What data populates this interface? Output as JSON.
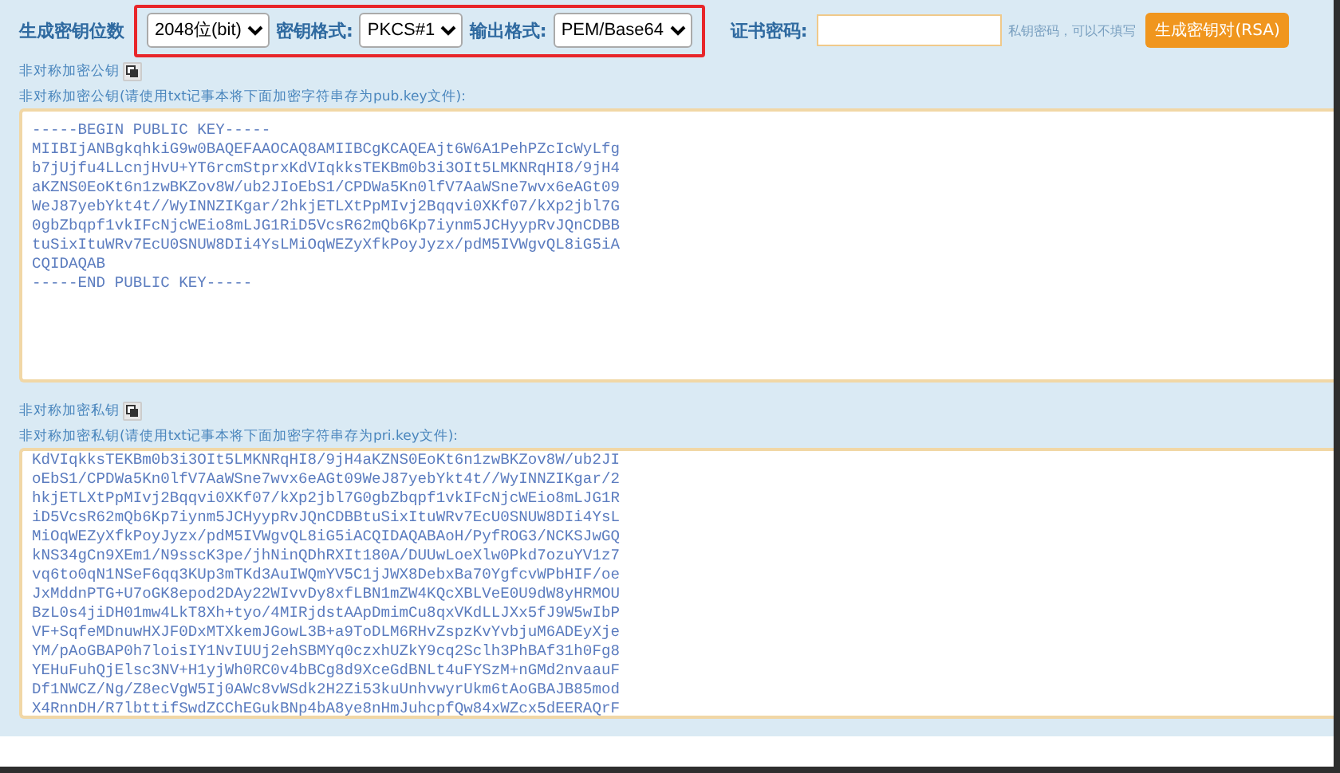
{
  "toolbar": {
    "key_size": {
      "label": "生成密钥位数",
      "value": "2048位(bit)"
    },
    "key_format": {
      "label": "密钥格式:",
      "value": "PKCS#1"
    },
    "output_format": {
      "label": "输出格式:",
      "value": "PEM/Base64"
    },
    "password": {
      "label": "证书密码:",
      "hint": "私钥密码，可以不填写"
    },
    "generate_button": "生成密钥对(RSA)"
  },
  "public_key": {
    "title": "非对称加密公钥",
    "label": "非对称加密公钥(请使用txt记事本将下面加密字符串存为pub.key文件):",
    "lines": [
      "-----BEGIN PUBLIC KEY-----",
      "MIIBIjANBgkqhkiG9w0BAQEFAAOCAQ8AMIIBCgKCAQEAjt6W6A1PehPZcIcWyLfg",
      "b7jUjfu4LLcnjHvU+YT6rcmStprxKdVIqkksTEKBm0b3i3OIt5LMKNRqHI8/9jH4",
      "aKZNS0EoKt6n1zwBKZov8W/ub2JIoEbS1/CPDWa5Kn0lfV7AaWSne7wvx6eAGt09",
      "WeJ87yebYkt4t//WyINNZIKgar/2hkjETLXtPpMIvj2Bqqvi0XKf07/kXp2jbl7G",
      "0gbZbqpf1vkIFcNjcWEio8mLJG1RiD5VcsR62mQb6Kp7iynm5JCHyypRvJQnCDBB",
      "tuSixItuWRv7EcU0SNUW8DIi4YsLMiOqWEZyXfkPoyJyzx/pdM5IVWgvQL8iG5iA",
      "CQIDAQAB",
      "-----END PUBLIC KEY-----"
    ]
  },
  "private_key": {
    "title": "非对称加密私钥",
    "label": "非对称加密私钥(请使用txt记事本将下面加密字符串存为pri.key文件):",
    "lines": [
      "KdVIqkksTEKBm0b3i3OIt5LMKNRqHI8/9jH4aKZNS0EoKt6n1zwBKZov8W/ub2JI",
      "oEbS1/CPDWa5Kn0lfV7AaWSne7wvx6eAGt09WeJ87yebYkt4t//WyINNZIKgar/2",
      "hkjETLXtPpMIvj2Bqqvi0XKf07/kXp2jbl7G0gbZbqpf1vkIFcNjcWEio8mLJG1R",
      "iD5VcsR62mQb6Kp7iynm5JCHyypRvJQnCDBBtuSixItuWRv7EcU0SNUW8DIi4YsL",
      "MiOqWEZyXfkPoyJyzx/pdM5IVWgvQL8iG5iACQIDAQABAoH/PyfROG3/NCKSJwGQ",
      "kNS34gCn9XEm1/N9sscK3pe/jhNinQDhRXIt180A/DUUwLoeXlw0Pkd7ozuYV1z7",
      "vq6to0qN1NSeF6qq3KUp3mTKd3AuIWQmYV5C1jJWX8DebxBa70YgfcvWPbHIF/oe",
      "JxMddnPTG+U7oGK8epod2DAy22WIvvDy8xfLBN1mZW4KQcXBLVeE0U9dW8yHRMOU",
      "BzL0s4jiDH01mw4LkT8Xh+tyo/4MIRjdstAApDmimCu8qxVKdLLJXx5fJ9W5wIbP",
      "VF+SqfeMDnuwHXJF0DxMTXkemJGowL3B+a9ToDLM6RHvZspzKvYvbjuM6ADEyXje",
      "YM/pAoGBAP0h7loisIY1NvIUUj2ehSBMYq0czxhUZkY9cq2Sclh3PhBAf31h0Fg8",
      "YEHuFuhQjElsc3NV+H1yjWh0RC0v4bBCg8d9XceGdBNLt4uFYSzM+nGMd2nvaauF",
      "Df1NWCZ/Ng/Z8ecVgW5Ij0AWc8vWSdk2H2Zi53kuUnhvwyrUkm6tAoGBAJB85mod",
      "X4RnnDH/R7lbttifSwdZCChEGukBNp4bA8ye8nHmJuhcpfQw84xWZcx5dEERAQrF"
    ]
  },
  "highlight": {
    "on": true
  }
}
